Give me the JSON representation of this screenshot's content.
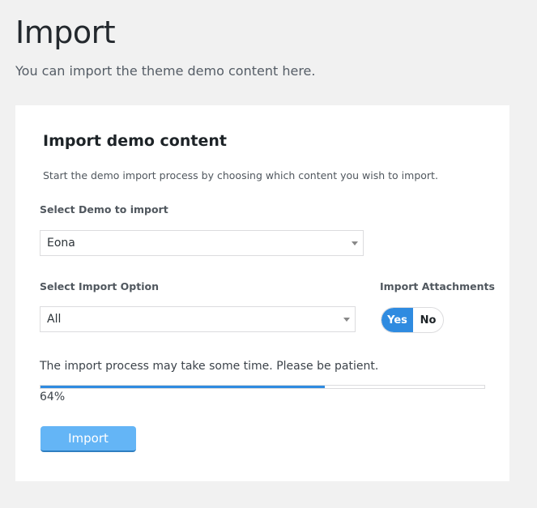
{
  "header": {
    "title": "Import",
    "subtitle": "You can import the theme demo content here."
  },
  "card": {
    "title": "Import demo content",
    "description": "Start the demo import process by choosing which content you wish to import.",
    "demo_select": {
      "label": "Select Demo to import",
      "value": "Eona"
    },
    "option_select": {
      "label": "Select Import Option",
      "value": "All"
    },
    "attachments": {
      "label": "Import Attachments",
      "yes_label": "Yes",
      "no_label": "No",
      "selected": "Yes"
    },
    "notice": "The import process may take some time. Please be patient.",
    "progress": {
      "value": 0.64,
      "text": "64%"
    },
    "import_button": "Import"
  },
  "colors": {
    "accent": "#2f8be0",
    "button": "#64b5f6",
    "background": "#f1f1f1"
  }
}
